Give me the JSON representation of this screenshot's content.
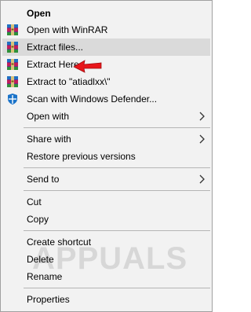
{
  "menu": {
    "items": {
      "open": {
        "label": "Open"
      },
      "open_with_winrar": {
        "label": "Open with WinRAR",
        "icon": "winrar-icon"
      },
      "extract_files": {
        "label": "Extract files...",
        "icon": "winrar-icon"
      },
      "extract_here": {
        "label": "Extract Here",
        "icon": "winrar-icon"
      },
      "extract_to": {
        "label": "Extract to \"atiadlxx\\\"",
        "icon": "winrar-icon"
      },
      "scan_defender": {
        "label": "Scan with Windows Defender...",
        "icon": "windows-defender-icon"
      },
      "open_with": {
        "label": "Open with"
      },
      "share_with": {
        "label": "Share with"
      },
      "restore_versions": {
        "label": "Restore previous versions"
      },
      "send_to": {
        "label": "Send to"
      },
      "cut": {
        "label": "Cut"
      },
      "copy": {
        "label": "Copy"
      },
      "create_shortcut": {
        "label": "Create shortcut"
      },
      "delete": {
        "label": "Delete"
      },
      "rename": {
        "label": "Rename"
      },
      "properties": {
        "label": "Properties"
      }
    }
  },
  "annotation": {
    "arrow_color": "#e8161b",
    "pointer": "red-arrow-icon"
  },
  "watermark": {
    "text": "APPUALS"
  },
  "colors": {
    "menu_bg": "#f2f2f2",
    "hover_bg": "#dadada",
    "border": "#a0a0a0"
  }
}
